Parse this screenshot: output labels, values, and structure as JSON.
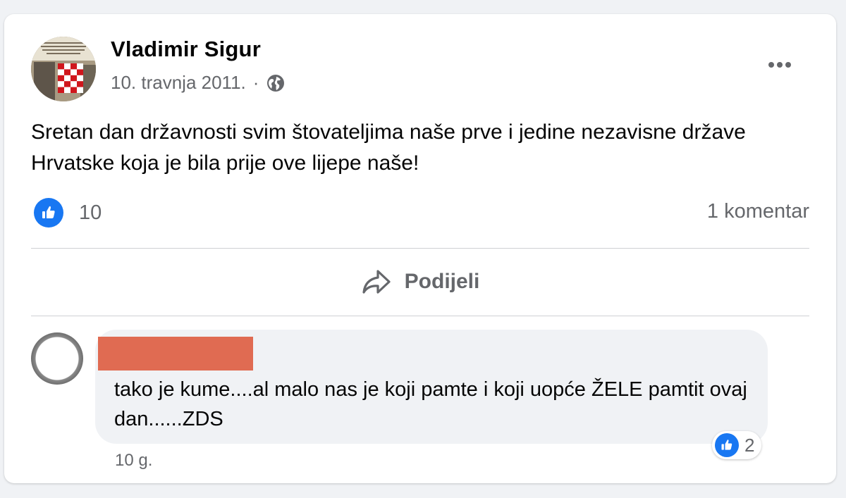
{
  "post": {
    "author": "Vladimir Sigur",
    "date": "10. travnja 2011.",
    "separator": "·",
    "visibility_icon": "globe-icon",
    "text": "Sretan dan državnosti svim štovateljima naše prve i jedine nezavisne države Hrvatske koja je bila prije ove lijepe naše!",
    "reaction_count": "10",
    "comment_count": "1 komentar",
    "share_label": "Podijeli"
  },
  "comment": {
    "text": "tako je kume....al malo nas je koji pamte i koji uopće ŽELE pamtit ovaj dan......ZDS",
    "reaction_count": "2",
    "time": "10 g."
  },
  "colors": {
    "like_blue": "#1877f2",
    "secondary_text": "#65676b",
    "redaction": "#e06b52"
  }
}
